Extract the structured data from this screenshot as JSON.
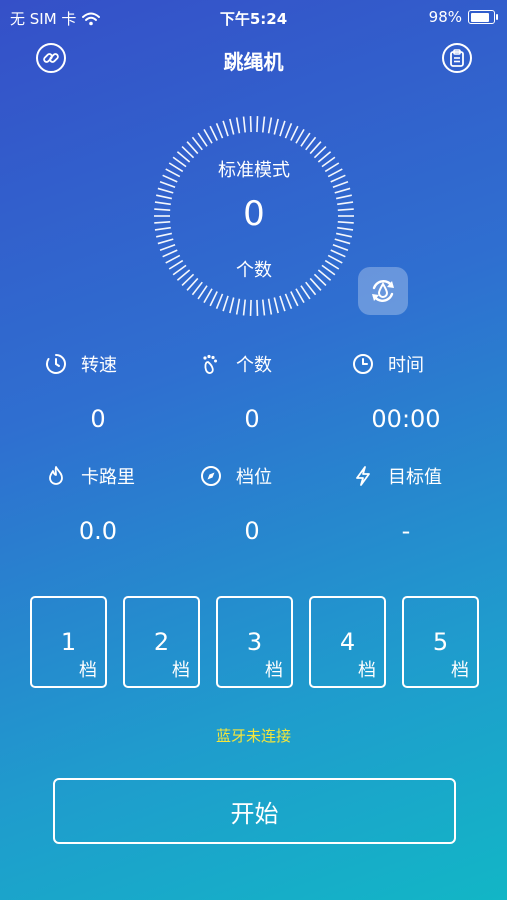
{
  "status_bar": {
    "carrier": "无 SIM 卡",
    "time": "下午5:24",
    "battery": "98%",
    "battery_level": 0.98
  },
  "nav": {
    "title": "跳绳机",
    "left_icon": "link-icon",
    "right_icon": "clipboard-icon"
  },
  "dial": {
    "mode": "标准模式",
    "count": "0",
    "unit": "个数"
  },
  "stats": [
    {
      "icon": "speed-icon",
      "label": "转速",
      "value": "0"
    },
    {
      "icon": "footprint-icon",
      "label": "个数",
      "value": "0"
    },
    {
      "icon": "clock-icon",
      "label": "时间",
      "value": "00:00"
    },
    {
      "icon": "flame-icon",
      "label": "卡路里",
      "value": "0.0"
    },
    {
      "icon": "compass-icon",
      "label": "档位",
      "value": "0"
    },
    {
      "icon": "lightning-icon",
      "label": "目标值",
      "value": "-"
    }
  ],
  "gears": [
    {
      "num": "1",
      "unit": "档"
    },
    {
      "num": "2",
      "unit": "档"
    },
    {
      "num": "3",
      "unit": "档"
    },
    {
      "num": "4",
      "unit": "档"
    },
    {
      "num": "5",
      "unit": "档"
    }
  ],
  "bluetooth_status": "蓝牙未连接",
  "start_label": "开始",
  "colors": {
    "gradient_start": "#3550c8",
    "gradient_end": "#12b6c6",
    "bluetooth_status": "#f5e63a"
  }
}
